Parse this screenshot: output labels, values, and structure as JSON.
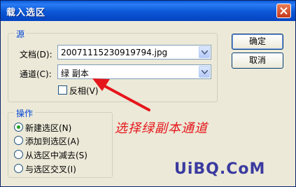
{
  "window": {
    "title": "载入选区"
  },
  "source_group": {
    "title": "源",
    "document": {
      "label": "文档(D):",
      "value": "20071115230919794.jpg"
    },
    "channel": {
      "label": "通道(C):",
      "value": "绿 副本"
    },
    "invert": {
      "label": "反相(V)",
      "checked": false
    }
  },
  "operation_group": {
    "title": "操作",
    "options": [
      {
        "label": "新建选区(N)",
        "selected": true
      },
      {
        "label": "添加到选区(A)",
        "selected": false
      },
      {
        "label": "从选区中减去(S)",
        "selected": false
      },
      {
        "label": "与选区交叉(I)",
        "selected": false
      }
    ]
  },
  "buttons": {
    "ok": "确定",
    "cancel": "取消"
  },
  "annotation": {
    "text": "选择绿副本通道",
    "color": "#e5161b"
  },
  "watermark": {
    "text": "UiBQ.CoM"
  }
}
